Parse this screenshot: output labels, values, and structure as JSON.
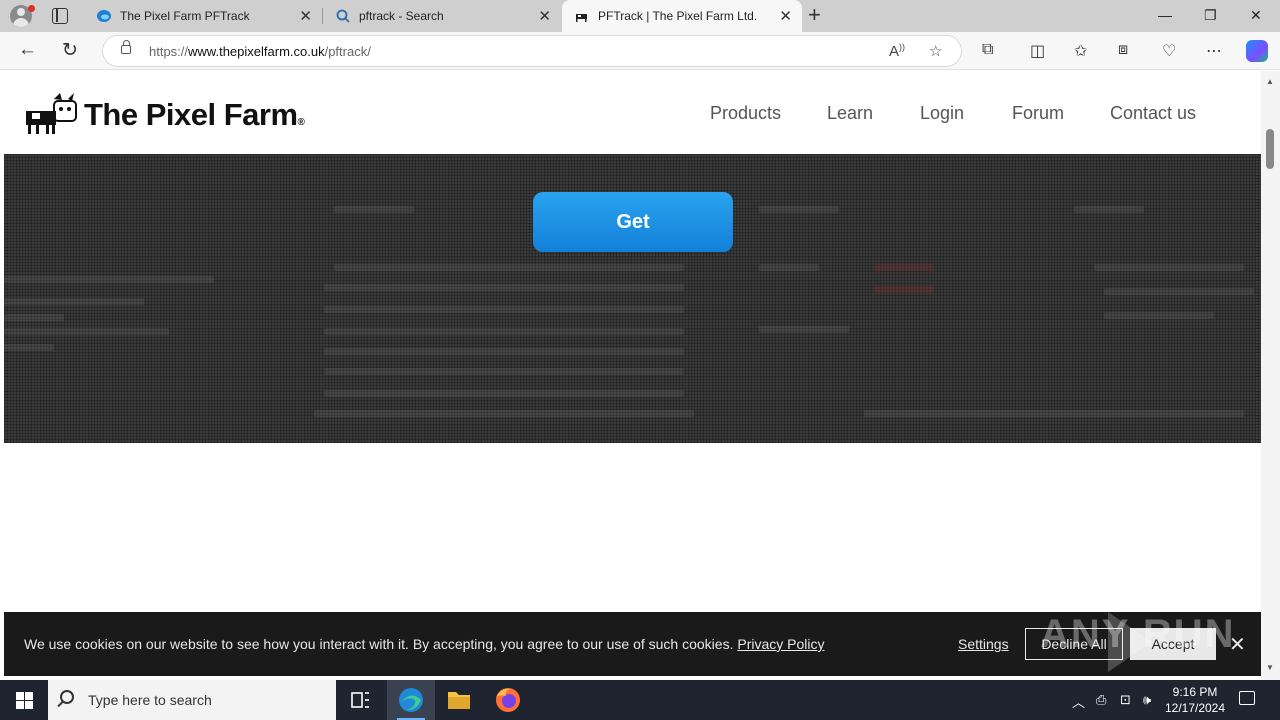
{
  "browser": {
    "tabs": [
      {
        "title": "The Pixel Farm PFTrack",
        "active": false
      },
      {
        "title": "pftrack - Search",
        "active": false
      },
      {
        "title": "PFTrack | The Pixel Farm Ltd.",
        "active": true
      }
    ],
    "url_prefix": "https://",
    "url_host": "www.thepixelfarm.co.uk",
    "url_path": "/pftrack/"
  },
  "site": {
    "logo_text": "The Pixel Farm",
    "logo_mark": "®",
    "nav": [
      "Products",
      "Learn",
      "Login",
      "Forum",
      "Contact us"
    ],
    "hero_button": "Get"
  },
  "cookie": {
    "text": "We use cookies on our website to see how you interact with it. By accepting, you agree to our use of such cookies.",
    "privacy_link": "Privacy Policy",
    "settings": "Settings",
    "decline": "Decline All",
    "accept": "Accept"
  },
  "watermark": "ANY RUN",
  "taskbar": {
    "search_placeholder": "Type here to search",
    "time": "9:16 PM",
    "date": "12/17/2024"
  },
  "colors": {
    "accent_button": "#1380d8",
    "hero_bg": "#3a3a3a",
    "cookie_bg": "#1a1a1a",
    "taskbar_bg": "#1f2530"
  }
}
